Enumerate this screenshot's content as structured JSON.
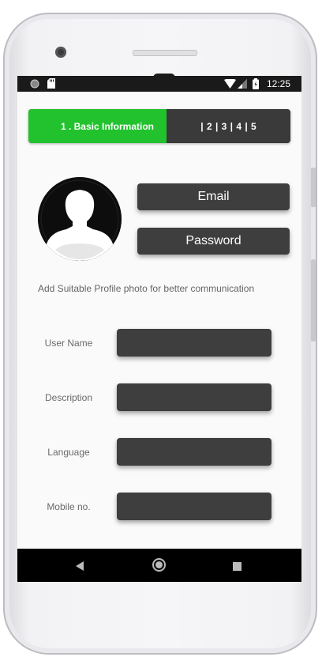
{
  "status_bar": {
    "time": "12:25",
    "icons": [
      "notification-dot-icon",
      "sd-card-icon",
      "wifi-icon",
      "signal-icon",
      "battery-icon"
    ]
  },
  "stepper": {
    "active_step": "1 . Basic Information",
    "remaining_steps": "| 2 | 3 | 4 | 5",
    "active_color": "#22c22e",
    "inactive_color": "#3a3a3a"
  },
  "profile": {
    "avatar_icon": "user-silhouette-icon",
    "email_label": "Email",
    "password_label": "Password",
    "hint": "Add Suitable Profile photo for better communication"
  },
  "form": {
    "fields": [
      {
        "label": "User Name",
        "value": ""
      },
      {
        "label": "Description",
        "value": ""
      },
      {
        "label": "Language",
        "value": ""
      },
      {
        "label": "Mobile no.",
        "value": ""
      }
    ]
  },
  "nav_bar": {
    "icons": [
      "back-icon",
      "home-icon",
      "recents-icon"
    ]
  }
}
